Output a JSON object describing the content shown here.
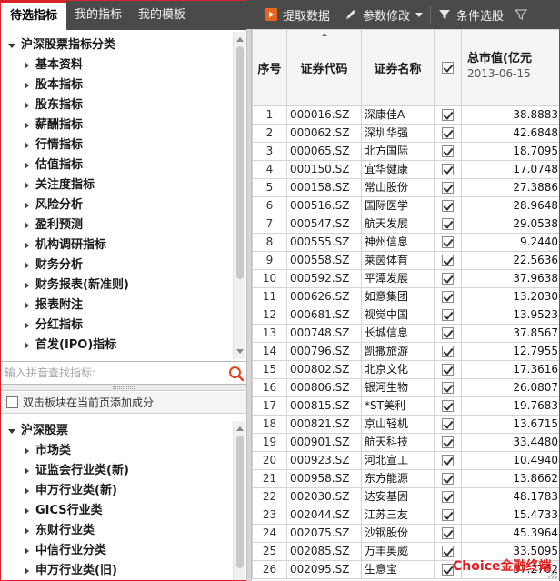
{
  "left_panel": {
    "tabs": [
      "待选指标",
      "我的指标",
      "我的模板"
    ],
    "indicator_tree": {
      "root": "沪深股票指标分类",
      "items": [
        "基本资料",
        "股本指标",
        "股东指标",
        "薪酬指标",
        "行情指标",
        "估值指标",
        "关注度指标",
        "风险分析",
        "盈利预测",
        "机构调研指标",
        "财务分析",
        "财务报表(新准则)",
        "报表附注",
        "分红指标",
        "首发(IPO)指标"
      ]
    },
    "search": {
      "placeholder": "输入拼音查找指标:"
    },
    "add_checkbox_label": "双击板块在当前页添加成分",
    "sector_tree": {
      "root": "沪深股票",
      "items": [
        "市场类",
        "证监会行业类(新)",
        "申万行业类(新)",
        "GICS行业类",
        "东财行业类",
        "中信行业分类",
        "申万行业类(旧)"
      ]
    }
  },
  "toolbar": {
    "extract_label": "提取数据",
    "params_label": "参数修改",
    "filter_label": "条件选股"
  },
  "table": {
    "headers": {
      "seq": "序号",
      "code": "证券代码",
      "name": "证券名称",
      "mv_title": "总市值(亿元",
      "mv_date": "2013-06-15"
    },
    "rows": [
      {
        "seq": "1",
        "code": "000016.SZ",
        "name": "深康佳A",
        "value": "38.8883"
      },
      {
        "seq": "2",
        "code": "000062.SZ",
        "name": "深圳华强",
        "value": "42.6848"
      },
      {
        "seq": "3",
        "code": "000065.SZ",
        "name": "北方国际",
        "value": "18.7095"
      },
      {
        "seq": "4",
        "code": "000150.SZ",
        "name": "宜华健康",
        "value": "17.0748"
      },
      {
        "seq": "5",
        "code": "000158.SZ",
        "name": "常山股份",
        "value": "27.3886"
      },
      {
        "seq": "6",
        "code": "000516.SZ",
        "name": "国际医学",
        "value": "28.9648"
      },
      {
        "seq": "7",
        "code": "000547.SZ",
        "name": "航天发展",
        "value": "29.0538"
      },
      {
        "seq": "8",
        "code": "000555.SZ",
        "name": "神州信息",
        "value": "9.2440"
      },
      {
        "seq": "9",
        "code": "000558.SZ",
        "name": "莱茵体育",
        "value": "22.5636"
      },
      {
        "seq": "10",
        "code": "000592.SZ",
        "name": "平潭发展",
        "value": "37.9638"
      },
      {
        "seq": "11",
        "code": "000626.SZ",
        "name": "如意集团",
        "value": "13.2030"
      },
      {
        "seq": "12",
        "code": "000681.SZ",
        "name": "视觉中国",
        "value": "13.9523"
      },
      {
        "seq": "13",
        "code": "000748.SZ",
        "name": "长城信息",
        "value": "37.8567"
      },
      {
        "seq": "14",
        "code": "000796.SZ",
        "name": "凯撒旅游",
        "value": "12.7955"
      },
      {
        "seq": "15",
        "code": "000802.SZ",
        "name": "北京文化",
        "value": "17.3616"
      },
      {
        "seq": "16",
        "code": "000806.SZ",
        "name": "银河生物",
        "value": "26.0807"
      },
      {
        "seq": "17",
        "code": "000815.SZ",
        "name": "*ST美利",
        "value": "19.7683"
      },
      {
        "seq": "18",
        "code": "000821.SZ",
        "name": "京山轻机",
        "value": "13.6715"
      },
      {
        "seq": "19",
        "code": "000901.SZ",
        "name": "航天科技",
        "value": "33.4480"
      },
      {
        "seq": "20",
        "code": "000923.SZ",
        "name": "河北宣工",
        "value": "10.4940"
      },
      {
        "seq": "21",
        "code": "000958.SZ",
        "name": "东方能源",
        "value": "13.8662"
      },
      {
        "seq": "22",
        "code": "002030.SZ",
        "name": "达安基因",
        "value": "48.1783"
      },
      {
        "seq": "23",
        "code": "002044.SZ",
        "name": "江苏三友",
        "value": "15.4733"
      },
      {
        "seq": "24",
        "code": "002075.SZ",
        "name": "沙钢股份",
        "value": "45.3964"
      },
      {
        "seq": "25",
        "code": "002085.SZ",
        "name": "万丰奥威",
        "value": "33.5095"
      },
      {
        "seq": "26",
        "code": "002095.SZ",
        "name": "生意宝",
        "value": "37.2762"
      }
    ]
  },
  "watermark": "Choice金融终端"
}
